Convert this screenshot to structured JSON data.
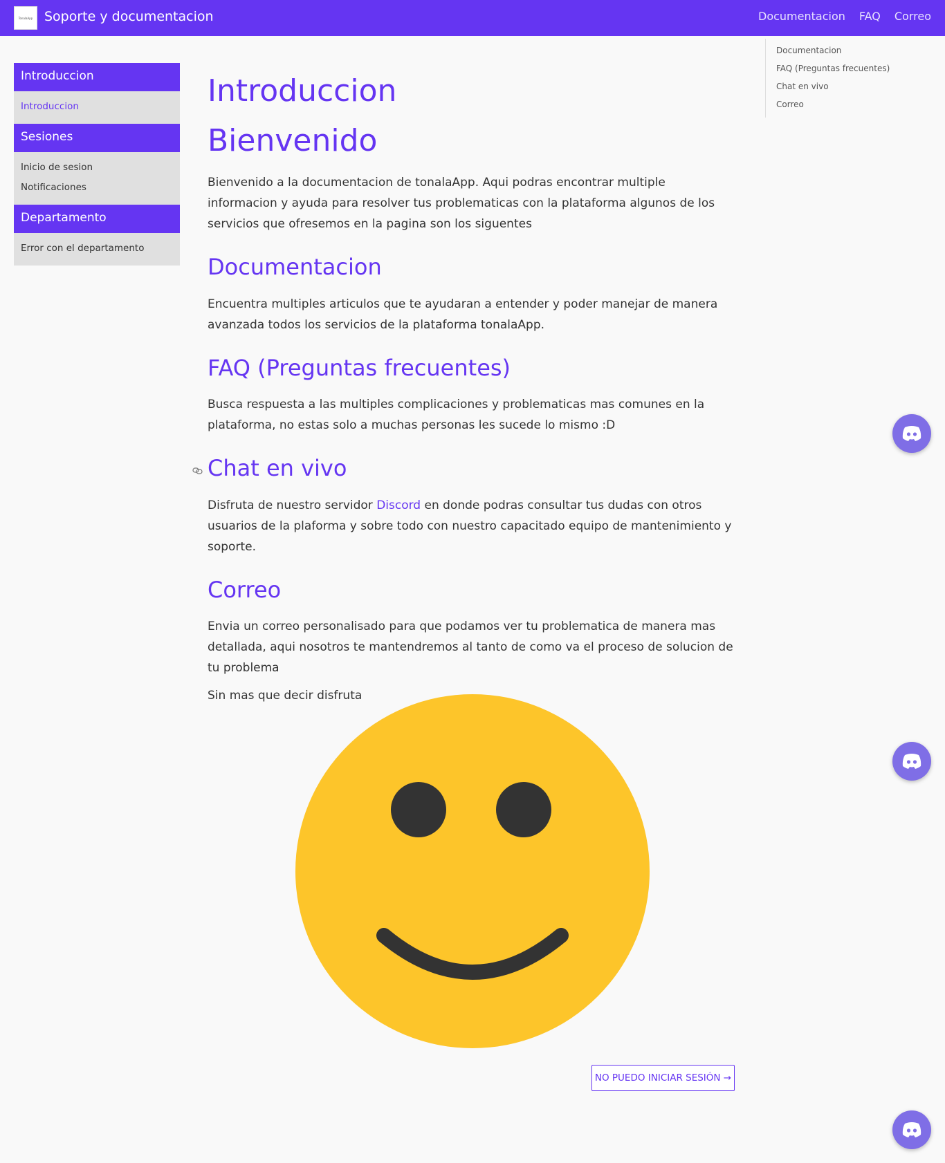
{
  "header": {
    "logo_text": "TonalaApp",
    "title": "Soporte y documentacion",
    "nav": [
      "Documentacion",
      "FAQ",
      "Correo"
    ]
  },
  "sidebar": {
    "groups": [
      {
        "title": "Introduccion",
        "items": [
          "Introduccion"
        ]
      },
      {
        "title": "Sesiones",
        "items": [
          "Inicio de sesion",
          "Notificaciones"
        ]
      },
      {
        "title": "Departamento",
        "items": [
          "Error con el departamento"
        ]
      }
    ]
  },
  "toc": [
    "Documentacion",
    "FAQ (Preguntas frecuentes)",
    "Chat en vivo",
    "Correo"
  ],
  "content": {
    "title": "Introduccion",
    "welcome_heading": "Bienvenido",
    "welcome_text": "Bienvenido a la documentacion de tonalaApp. Aqui podras encontrar multiple informacion y ayuda para resolver tus problematicas con la plataforma algunos de los servicios que ofresemos en la pagina son los siguentes",
    "doc_heading": "Documentacion",
    "doc_text": "Encuentra multiples articulos que te ayudaran a entender y poder manejar de manera avanzada todos los servicios de la plataforma tonalaApp.",
    "faq_heading": "FAQ (Preguntas frecuentes)",
    "faq_text": "Busca respuesta a las multiples complicaciones y problematicas mas comunes en la plataforma, no estas solo a muchas personas les sucede lo mismo :D",
    "chat_heading": "Chat en vivo",
    "chat_text_before": "Disfruta de nuestro servidor ",
    "chat_link": "Discord",
    "chat_text_after": " en donde podras consultar tus dudas con otros usuarios de la plaforma y sobre todo con nuestro capacitado equipo de mantenimiento y soporte.",
    "mail_heading": "Correo",
    "mail_text": "Envia un correo personalisado para que podamos ver tu problematica de manera mas detallada, aqui nosotros te mantendremos al tanto de como va el proceso de solucion de tu problema",
    "closing_text": "Sin mas que decir disfruta"
  },
  "cta": {
    "label": "NO PUEDO INICIAR SESIÓN →"
  },
  "colors": {
    "accent": "#6535f2",
    "sidebar_bg": "#e0e0e0",
    "smiley": "#fdc52a",
    "discord": "#7f6ee6"
  },
  "icons": [
    "smiley-face-icon",
    "link-icon",
    "discord-icon"
  ]
}
